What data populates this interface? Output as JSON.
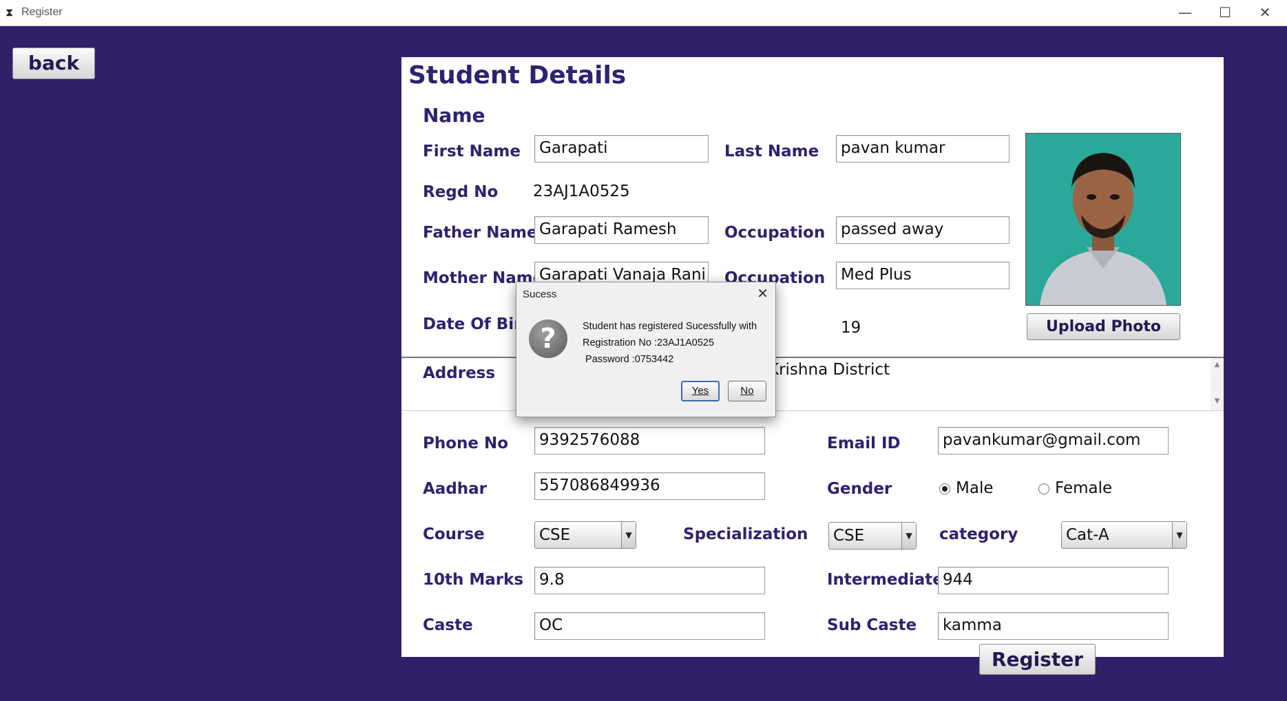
{
  "window": {
    "title": "Register",
    "controls": {
      "minimize": "—",
      "maximize": "☐",
      "close": "✕"
    }
  },
  "nav": {
    "back_label": "back"
  },
  "form": {
    "heading": "Student Details",
    "section_name": "Name",
    "first_name": {
      "label": "First Name",
      "value": "Garapati"
    },
    "last_name": {
      "label": "Last Name",
      "value": "pavan kumar"
    },
    "regd_no": {
      "label": "Regd No",
      "value": "23AJ1A0525"
    },
    "father_name": {
      "label": "Father Name",
      "value": "Garapati Ramesh"
    },
    "father_occupation": {
      "label": "Occupation",
      "value": "passed away"
    },
    "mother_name": {
      "label": "Mother Name",
      "value": "Garapati Vanaja Rani"
    },
    "mother_occupation": {
      "label": "Occupation",
      "value": "Med Plus"
    },
    "dob": {
      "label": "Date Of Birth",
      "age_value": "19"
    },
    "upload_photo_label": "Upload Photo",
    "address": {
      "label": "Address",
      "visible_text": "Krishna District"
    },
    "phone": {
      "label": "Phone No",
      "value": "9392576088"
    },
    "email": {
      "label": "Email ID",
      "value": "pavankumar@gmail.com"
    },
    "aadhar": {
      "label": "Aadhar",
      "value": "557086849936"
    },
    "gender": {
      "label": "Gender",
      "options": [
        "Male",
        "Female"
      ],
      "selected": "Male"
    },
    "course": {
      "label": "Course",
      "value": "CSE"
    },
    "specialization": {
      "label": "Specialization",
      "value": "CSE"
    },
    "category": {
      "label": "category",
      "value": "Cat-A"
    },
    "tenth_marks": {
      "label": "10th Marks",
      "value": "9.8"
    },
    "intermediate": {
      "label": "Intermediate",
      "value": "944"
    },
    "caste": {
      "label": "Caste",
      "value": "OC"
    },
    "sub_caste": {
      "label": "Sub Caste",
      "value": "kamma"
    },
    "register_label": "Register"
  },
  "dialog": {
    "title": "Sucess",
    "close_glyph": "✕",
    "icon_glyph": "?",
    "line1": "Student has registered Sucessfully with",
    "line2": "Registration No :23AJ1A0525",
    "line3": " Password :0753442",
    "yes_label": "Yes",
    "no_label": "No"
  },
  "colors": {
    "background": "#30206a",
    "label": "#2c2370",
    "photo_bg": "#2aa89a"
  }
}
